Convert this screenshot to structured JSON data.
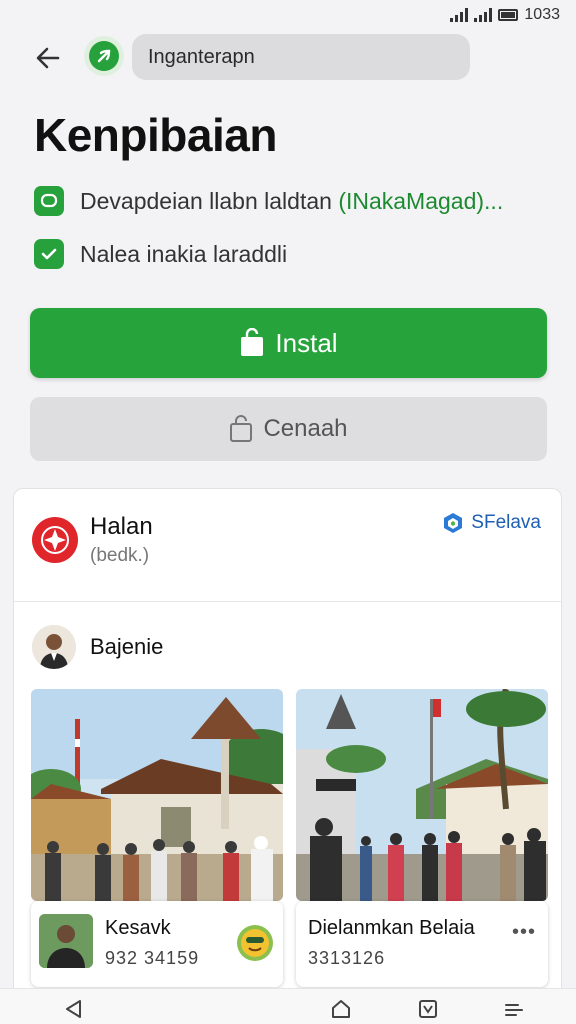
{
  "status_bar": {
    "time": "1033"
  },
  "header": {
    "search_text": "Inganterapn"
  },
  "app": {
    "title": "Kenpibaian",
    "features": [
      {
        "text": "Devapdeian llabn laldtan ",
        "highlight": "(INakaMagad)..."
      },
      {
        "text": "Nalea inakia laraddli",
        "highlight": ""
      }
    ]
  },
  "actions": {
    "install_label": "Instal",
    "cancel_label": "Cenaah"
  },
  "card": {
    "publisher_name": "Halan",
    "publisher_sub": "(bedk.)",
    "partner_label": "SFelava",
    "author_name": "Bajenie",
    "items": [
      {
        "name": "Kesavk",
        "number": "932 34159"
      },
      {
        "name": "Dielanmkan Belaia",
        "number": "3313126"
      }
    ]
  },
  "colors": {
    "accent_green": "#26a33b",
    "brand_red": "#e0252b",
    "link_blue": "#1e5fb4"
  }
}
